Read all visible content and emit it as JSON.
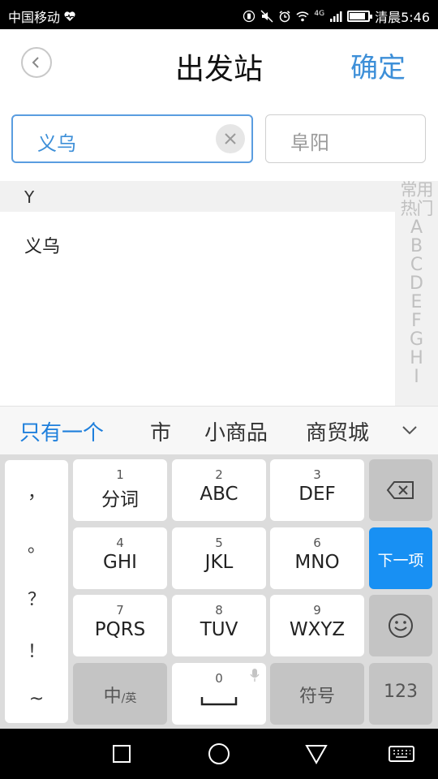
{
  "status_bar": {
    "carrier": "中国移动",
    "time": "清晨5:46",
    "network": "4G",
    "battery_level": 0.85
  },
  "header": {
    "title": "出发站",
    "confirm_label": "确定",
    "back_icon": "chevron-left-icon"
  },
  "stations": {
    "from_value": "义乌",
    "to_placeholder": "阜阳"
  },
  "list": {
    "section_letter": "Y",
    "items": [
      "义乌"
    ]
  },
  "index_bar": {
    "items": [
      "常用",
      "热门",
      "A",
      "B",
      "C",
      "D",
      "E",
      "F",
      "G",
      "H",
      "I"
    ]
  },
  "ime": {
    "candidates": [
      "只有一个",
      "市",
      "小商品",
      "商贸城"
    ],
    "punctuation": [
      "，",
      "。",
      "？",
      "！",
      "~"
    ],
    "keys": [
      {
        "num": "1",
        "label": "分词"
      },
      {
        "num": "2",
        "label": "ABC"
      },
      {
        "num": "3",
        "label": "DEF"
      },
      {
        "num": "4",
        "label": "GHI"
      },
      {
        "num": "5",
        "label": "JKL"
      },
      {
        "num": "6",
        "label": "MNO"
      },
      {
        "num": "7",
        "label": "PQRS"
      },
      {
        "num": "8",
        "label": "TUV"
      },
      {
        "num": "9",
        "label": "WXYZ"
      }
    ],
    "next_label": "下一项",
    "lang_zh": "中",
    "lang_en": "/英",
    "space_num": "0",
    "symbols_label": "符号",
    "numbers_label": "123",
    "accent": "#1890f3"
  },
  "colors": {
    "accent": "#3d8fd8",
    "candidate_highlight": "#1e7fdc"
  }
}
